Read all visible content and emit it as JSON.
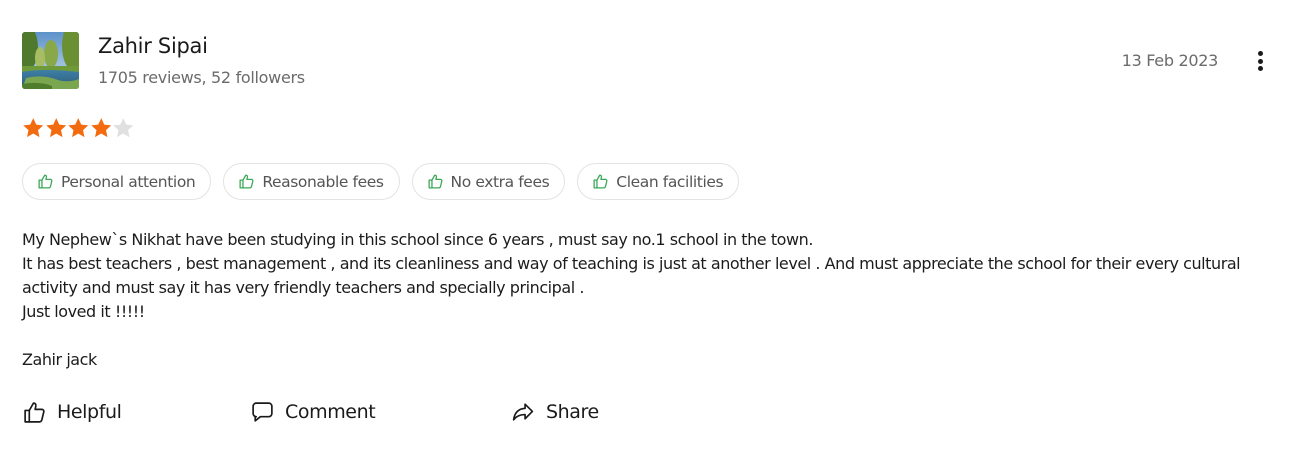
{
  "reviewer": {
    "name": "Zahir Sipai",
    "meta": "1705 reviews, 52 followers",
    "avatar_icon": "landscape-avatar"
  },
  "review": {
    "date": "13 Feb 2023",
    "rating": 4,
    "rating_max": 5,
    "star_color": "#f26b0f",
    "star_empty_color": "#e0e0e0",
    "tags": [
      {
        "label": "Personal attention",
        "icon": "thumbs-up-icon"
      },
      {
        "label": "Reasonable fees",
        "icon": "thumbs-up-icon"
      },
      {
        "label": "No extra fees",
        "icon": "thumbs-up-icon"
      },
      {
        "label": "Clean facilities",
        "icon": "thumbs-up-icon"
      }
    ],
    "tag_icon_color": "#3aa757",
    "text_lines": [
      "My Nephew`s Nikhat have been studying in this school since 6 years , must say no.1 school in the town.",
      "It has best teachers , best management , and its cleanliness and way of teaching is just at another level . And must appreciate the school for their every cultural activity and must say it has very friendly teachers and specially principal .",
      "Just loved it !!!!!",
      "Zahir jack"
    ]
  },
  "actions": {
    "helpful_label": "Helpful",
    "comment_label": "Comment",
    "share_label": "Share"
  },
  "menu": {
    "icon": "more-vertical-icon"
  }
}
